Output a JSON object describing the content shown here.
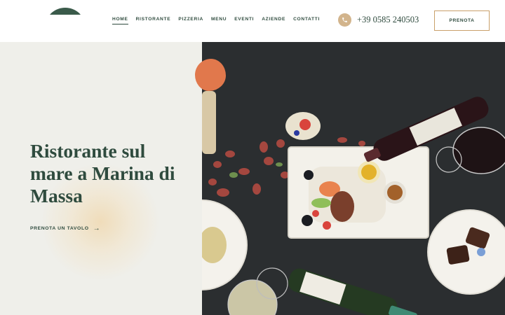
{
  "nav": {
    "items": [
      {
        "label": "HOME",
        "active": true
      },
      {
        "label": "RISTORANTE",
        "active": false
      },
      {
        "label": "PIZZERIA",
        "active": false
      },
      {
        "label": "MENU",
        "active": false
      },
      {
        "label": "EVENTI",
        "active": false
      },
      {
        "label": "AZIENDE",
        "active": false
      },
      {
        "label": "CONTATTI",
        "active": false
      }
    ]
  },
  "contact": {
    "phone": "+39 0585 240503",
    "phone_icon": "phone-icon"
  },
  "header": {
    "cta_label": "PRENOTA"
  },
  "hero": {
    "title": "Ristorante sul mare a Marina di Massa",
    "cta_label": "PRENOTA UN TAVOLO",
    "cta_icon": "arrow-right-icon"
  },
  "colors": {
    "brand_green": "#2f4b3e",
    "accent_gold": "#c9a06a",
    "accent_orange": "#e1784c",
    "panel_bg": "#efefea"
  }
}
